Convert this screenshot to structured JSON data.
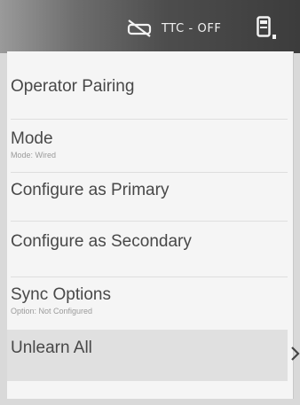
{
  "status_bar": {
    "ttc_icon": "sync-disabled-icon",
    "ttc_label": "TTC - OFF",
    "battery_icon": "battery-icon",
    "background_color": "#3c3c3c",
    "text_color": "#f2f2f2"
  },
  "menu": {
    "items": [
      {
        "label": "Operator Pairing",
        "sub": ""
      },
      {
        "label": "Mode",
        "sub": "Mode: Wired"
      },
      {
        "label": "Configure as Primary",
        "sub": ""
      },
      {
        "label": "Configure as Secondary",
        "sub": ""
      },
      {
        "label": "Sync Options",
        "sub": "Option: Not Configured"
      },
      {
        "label": "Unlearn All",
        "sub": ""
      }
    ],
    "selected_index": 5,
    "selected_icon": "chevron-right-icon"
  }
}
